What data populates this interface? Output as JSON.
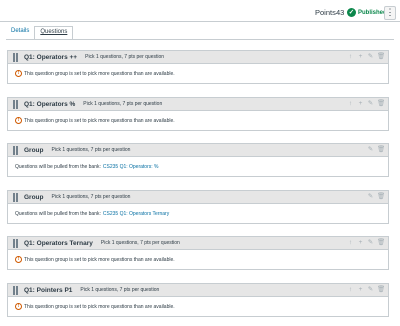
{
  "header": {
    "points_label": "Points",
    "points_value": "43",
    "published_label": "Published",
    "more_label": "⋮"
  },
  "tabs": [
    {
      "label": "Details",
      "active": false
    },
    {
      "label": "Questions",
      "active": true
    }
  ],
  "groups": [
    {
      "title": "Q1: Operators ++",
      "desc": "Pick 1 questions, 7 pts per question",
      "message": "This question group is set to pick more questions than are available.",
      "type": "warning"
    },
    {
      "title": "Q1: Operators %",
      "desc": "Pick 1 questions, 7 pts per question",
      "message": "This question group is set to pick more questions than are available.",
      "type": "warning"
    },
    {
      "title": "Group",
      "desc": "Pick 1 questions, 7 pts per question",
      "message": "Questions will be pulled from the bank:",
      "bank": "CS235 Q1: Operators: %",
      "type": "bank"
    },
    {
      "title": "Group",
      "desc": "Pick 1 questions, 7 pts per question",
      "message": "Questions will be pulled from the bank:",
      "bank": "CS235 Q1: Operators Ternary",
      "type": "bank"
    },
    {
      "title": "Q1: Operators Ternary",
      "desc": "Pick 1 questions, 7 pts per question",
      "message": "This question group is set to pick more questions than are available.",
      "type": "warning"
    },
    {
      "title": "Q1: Pointers P1",
      "desc": "Pick 1 questions, 7 pts per question",
      "message": "This question group is set to pick more questions than are available.",
      "type": "warning"
    }
  ],
  "icons": {
    "warning": "warning-icon",
    "move": "move-arrow-icon",
    "add": "plus-icon",
    "edit": "pencil-icon",
    "delete": "trash-icon",
    "published": "check-circle-icon"
  },
  "colors": {
    "accent_link": "#0770a3",
    "published_green": "#0b874b",
    "warning_orange": "#d05a00",
    "header_bg": "#e6e6e6"
  }
}
